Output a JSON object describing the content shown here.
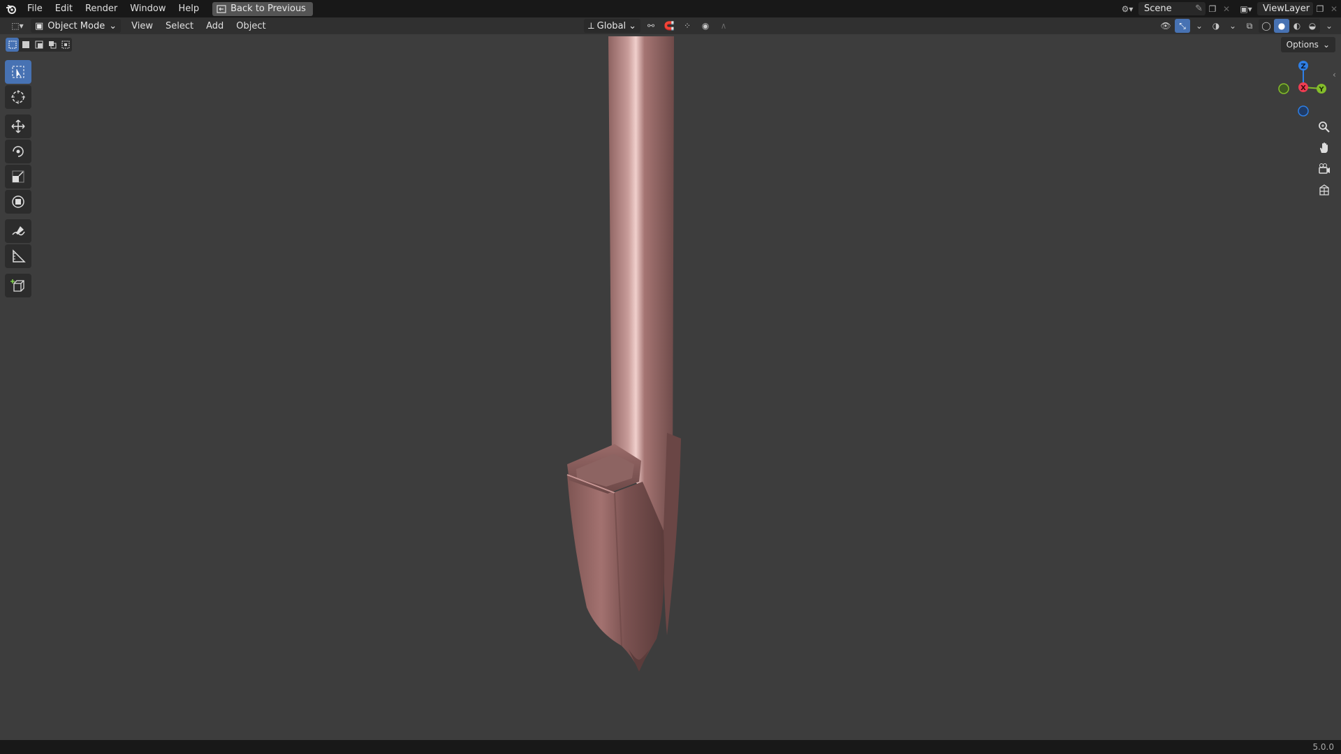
{
  "topbar": {
    "menu": [
      "File",
      "Edit",
      "Render",
      "Window",
      "Help"
    ],
    "back_button": "Back to Previous",
    "scene_name": "Scene",
    "view_layer": "ViewLayer"
  },
  "header": {
    "mode": "Object Mode",
    "menus": [
      "View",
      "Select",
      "Add",
      "Object"
    ],
    "transform_orientation": "Global",
    "options_label": "Options"
  },
  "gizmo": {
    "axes": [
      "Z",
      "X",
      "Y"
    ],
    "colors": {
      "x": "#ee3d52",
      "y": "#84bd2a",
      "z": "#2e7fe6",
      "neg_y": "#5a7a30",
      "neg_z": "#2a4f85"
    }
  },
  "toolbar": {
    "tools": [
      "select-box-tool",
      "cursor-tool",
      "move-tool",
      "rotate-tool",
      "scale-tool",
      "transform-tool",
      "annotate-tool",
      "measure-tool",
      "add-cube-tool"
    ]
  },
  "nav": [
    "zoom-icon",
    "pan-hand-icon",
    "camera-view-icon",
    "orthographic-grid-icon"
  ],
  "status": {
    "version": "5.0.0"
  },
  "colors": {
    "viewport": "#3d3d3d",
    "accent": "#4772b3",
    "model": "#a97572"
  }
}
